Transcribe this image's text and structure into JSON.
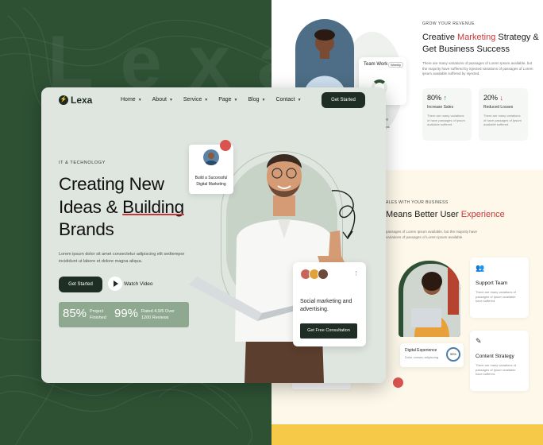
{
  "brand": {
    "name": "Lexa",
    "mark": "⚡",
    "watermark": "Lexa"
  },
  "nav": {
    "items": [
      {
        "label": "Home"
      },
      {
        "label": "About"
      },
      {
        "label": "Service"
      },
      {
        "label": "Page"
      },
      {
        "label": "Blog"
      },
      {
        "label": "Contact"
      }
    ],
    "cta": "Get Started"
  },
  "hero": {
    "eyebrow": "IT & TECHNOLOGY",
    "headline_1": "Creating New",
    "headline_2a": "Ideas & ",
    "headline_2b": "Building",
    "headline_3": "Brands",
    "lede": "Lorem ipsum dolor sit amet consectetur adipiscing elit sedtempor incididunt ut labore et dolore magna aliqua.",
    "primary_button": "Get Started",
    "watch_label": "Watch Video",
    "stats": [
      {
        "value": "85%",
        "label_1": "Project",
        "label_2": "Finished"
      },
      {
        "value": "99%",
        "label_1": "Rated 4.9/5 Over",
        "label_2": "1200 Reviews"
      }
    ],
    "badge_1": "Build a Successful",
    "badge_2": "Digital Marketing",
    "social_text": "Social marketing and advertising.",
    "social_button": "Get Free Consultation",
    "dots": "⋮"
  },
  "right_top": {
    "team_label": "Team Work",
    "weekly": "Weekly",
    "tag_1": "eting",
    "tag_2": "ations",
    "eyebrow": "GROW YOUR REVENUE",
    "title_pre": "Creative ",
    "title_accent": "Marketing",
    "title_post": " Strategy & Get Business Success",
    "para": "There are many variations of passages of Lorem Ipsum available, but the majority have suffered by injected variations of passages of Lorem ipsum available suffered by injected.",
    "stats": [
      {
        "value": "80%",
        "arrow": "↑",
        "label": "Increase Sales",
        "text": "There are many variations of have passages of Ipsum available suffered."
      },
      {
        "value": "20%",
        "arrow": "↓",
        "label": "Reduced Losses",
        "text": "There are many variations of have passages of Ipsum available suffered."
      }
    ]
  },
  "right_mid": {
    "eyebrow": "ALES WITH YOUR BUSINESS",
    "title_pre": "Means Better User ",
    "title_accent": "Experience",
    "para": "passages of Lorem Ipsum available, but the majority have variations of passages of Lorem Ipsum available",
    "dx_title": "Digital Experience",
    "dx_sub": "Dolor consec adipiscing",
    "dx_value": "95%",
    "cards": [
      {
        "icon": "👥",
        "title": "Support Team",
        "text": "There are many variations of passages of Ipsum available have suffered."
      },
      {
        "icon": "✎",
        "title": "Content Strategy",
        "text": "There are many variations of passages of Ipsum available have suffered."
      }
    ]
  },
  "colors": {
    "green_dark": "#2e5134",
    "navy_btn": "#1e2e24",
    "accent_red": "#c8373a",
    "hero_bg": "#dfe5df",
    "stat_green": "#8fa890",
    "cream": "#fdf8ea",
    "yellow": "#f7c948"
  },
  "icons": [
    "chevron-down-icon",
    "play-icon",
    "rocket-icon",
    "arrow-doodle-icon",
    "more-icon",
    "users-icon",
    "edit-icon"
  ]
}
